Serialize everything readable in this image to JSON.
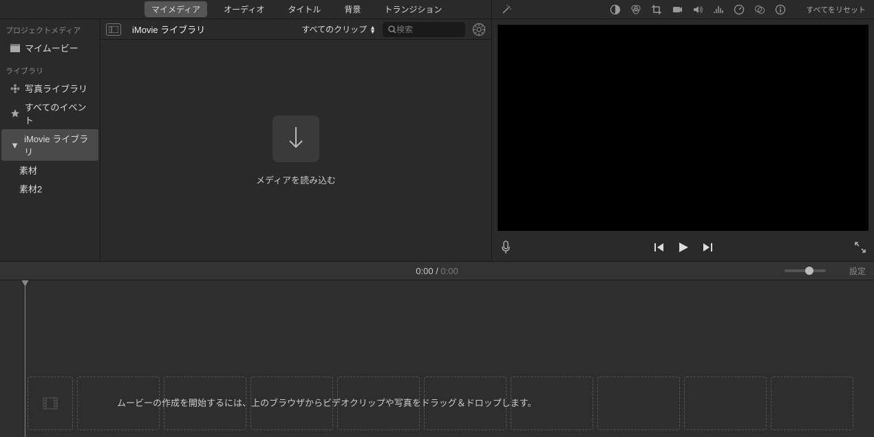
{
  "tabs": {
    "my_media": "マイメディア",
    "audio": "オーディオ",
    "titles": "タイトル",
    "backgrounds": "背景",
    "transitions": "トランジション"
  },
  "sidebar": {
    "project_media_header": "プロジェクトメディア",
    "my_movie": "マイムービー",
    "library_header": "ライブラリ",
    "photo_library": "写真ライブラリ",
    "all_events": "すべてのイベント",
    "imovie_library": "iMovie ライブラリ",
    "sozai1": "素材",
    "sozai2": "素材2"
  },
  "browser": {
    "title": "iMovie ライブラリ",
    "filter": "すべてのクリップ",
    "search_placeholder": "検索",
    "import_label": "メディアを読み込む"
  },
  "viewer": {
    "reset_all": "すべてをリセット"
  },
  "timebar": {
    "current": "0:00",
    "sep": " / ",
    "duration": "0:00",
    "settings": "設定"
  },
  "timeline": {
    "hint": "ムービーの作成を開始するには、上のブラウザからビデオクリップや写真をドラッグ＆ドロップします。"
  }
}
